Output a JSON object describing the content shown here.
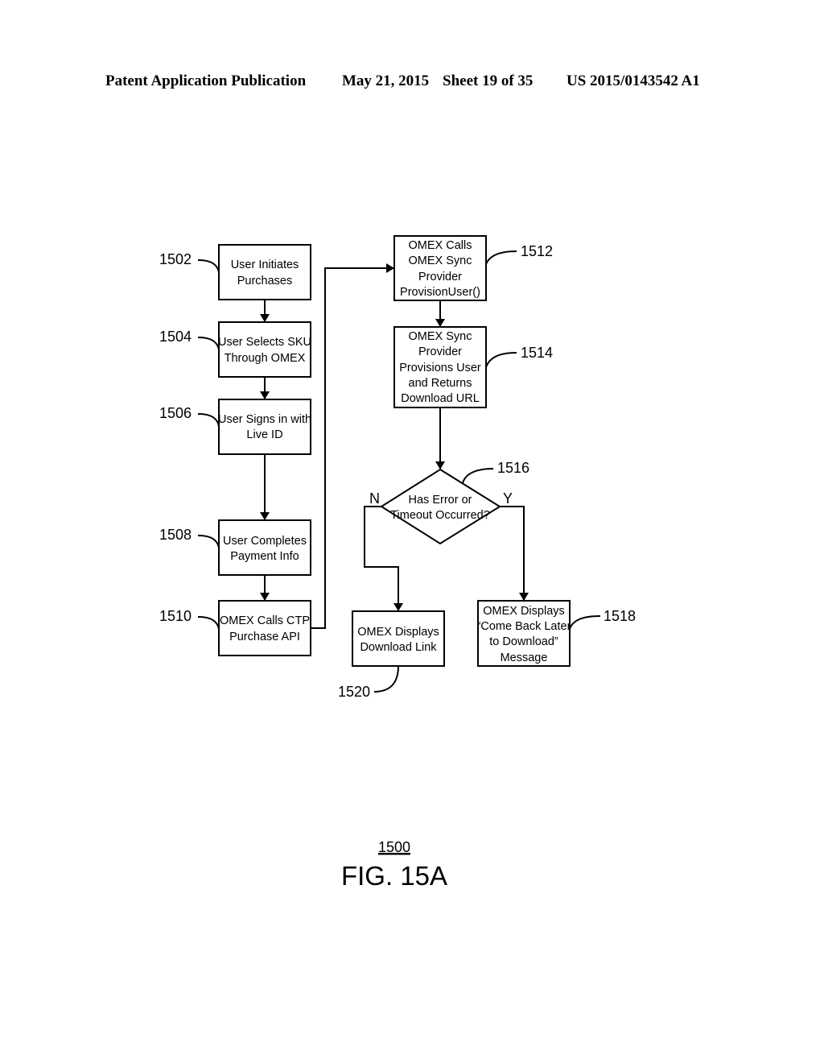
{
  "header": {
    "publication": "Patent Application Publication",
    "date": "May 21, 2015",
    "sheet": "Sheet 19 of 35",
    "number": "US 2015/0143542 A1"
  },
  "figure": {
    "ref": "1500",
    "title": "FIG. 15A"
  },
  "nodes": {
    "n1502": {
      "ref": "1502",
      "lines": [
        "User Initiates",
        "Purchases"
      ]
    },
    "n1504": {
      "ref": "1504",
      "lines": [
        "User Selects SKU",
        "Through OMEX"
      ]
    },
    "n1506": {
      "ref": "1506",
      "lines": [
        "User Signs in with",
        "Live ID"
      ]
    },
    "n1508": {
      "ref": "1508",
      "lines": [
        "User Completes",
        "Payment Info"
      ]
    },
    "n1510": {
      "ref": "1510",
      "lines": [
        "OMEX Calls CTP",
        "Purchase API"
      ]
    },
    "n1512": {
      "ref": "1512",
      "lines": [
        "OMEX Calls",
        "OMEX Sync",
        "Provider",
        "ProvisionUser()"
      ]
    },
    "n1514": {
      "ref": "1514",
      "lines": [
        "OMEX Sync",
        "Provider",
        "Provisions User",
        "and Returns",
        "Download URL"
      ]
    },
    "n1516": {
      "ref": "1516",
      "lines": [
        "Has Error or",
        "Timeout Occurred?"
      ],
      "no_label": "N",
      "yes_label": "Y"
    },
    "n1518": {
      "ref": "1518",
      "lines": [
        "OMEX Displays",
        "“Come Back Later",
        "to Download”",
        "Message"
      ]
    },
    "n1520": {
      "ref": "1520",
      "lines": [
        "OMEX Displays",
        "Download Link"
      ]
    }
  }
}
